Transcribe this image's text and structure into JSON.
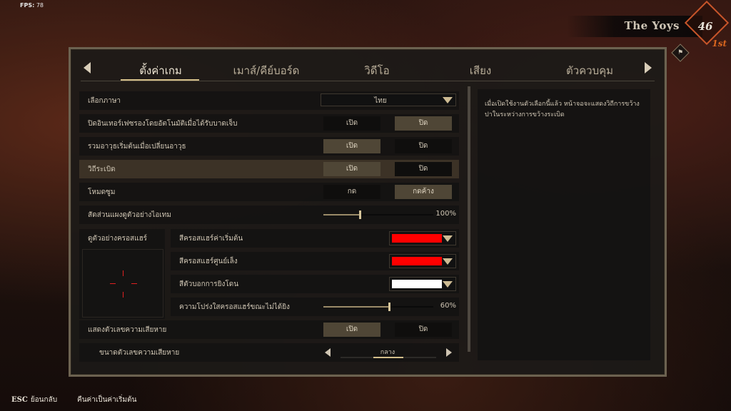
{
  "fps": {
    "label": "FPS:",
    "value": "78"
  },
  "profile": {
    "name": "The Yoys",
    "level": "46",
    "rank": "1st",
    "badge_icon": "flag-icon"
  },
  "tabs": [
    {
      "label": "ตั้งค่าเกม",
      "active": true
    },
    {
      "label": "เมาส์/คีย์บอร์ด"
    },
    {
      "label": "วิดีโอ"
    },
    {
      "label": "เสียง"
    },
    {
      "label": "ตัวควบคุม"
    }
  ],
  "settings": {
    "language": {
      "label": "เลือกภาษา",
      "value": "ไทย"
    },
    "auto_interrupt": {
      "label": "ปิดอินเทอร์เฟซรองโดยอัตโนมัติเมื่อได้รับบาดเจ็บ",
      "on": "เปิด",
      "off": "ปิด",
      "selected": "off"
    },
    "weapon_merge": {
      "label": "รวมอาวุธเริ่มต้นเมื่อเปลี่ยนอาวุธ",
      "on": "เปิด",
      "off": "ปิด",
      "selected": "on"
    },
    "skill_bomb": {
      "label": "วิถีระเบิด",
      "on": "เปิด",
      "off": "ปิด",
      "selected": "on"
    },
    "zoom_mode": {
      "label": "โหมดซูม",
      "on": "กด",
      "off": "กดค้าง",
      "selected": "off"
    },
    "item_preview_scale": {
      "label": "สัดส่วนแผงดูตัวอย่างไอเทม",
      "value": 100,
      "display": "100%"
    },
    "crosshair_preview": {
      "label": "ดูตัวอย่างครอสแฮร์"
    },
    "crosshair_default_color": {
      "label": "สีครอสแฮร์ค่าเริ่มต้น",
      "color": "#ff0000"
    },
    "crosshair_center_color": {
      "label": "สีครอสแฮร์ศูนย์เล็ง",
      "color": "#ff0000"
    },
    "hit_marker_color": {
      "label": "สีตัวบอกการยิงโดน",
      "color": "#ffffff"
    },
    "crosshair_opacity": {
      "label": "ความโปร่งใสครอสแฮร์ขณะไม่ได้ยิง",
      "value": 60,
      "display": "60%"
    },
    "damage_numbers": {
      "label": "แสดงตัวเลขความเสียหาย",
      "on": "เปิด",
      "off": "ปิด",
      "selected": "on"
    },
    "damage_number_size": {
      "label": "ขนาดตัวเลขความเสียหาย",
      "value": "กลาง"
    }
  },
  "description": "เมื่อเปิดใช้งานตัวเลือกนี้แล้ว หน้าจอจะแสดงวิถีการขว้างปาในระหว่างการขว้างระเบิด",
  "footer": {
    "back_key": "ESC",
    "back_label": "ย้อนกลับ",
    "reset_label": "คืนค่าเป็นค่าเริ่มต้น"
  }
}
